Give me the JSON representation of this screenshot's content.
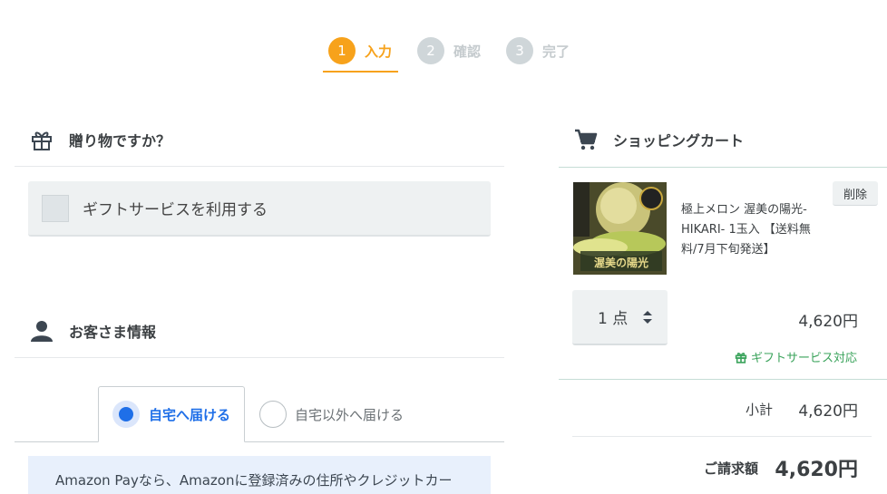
{
  "steps": [
    {
      "num": "1",
      "label": "入力"
    },
    {
      "num": "2",
      "label": "確認"
    },
    {
      "num": "3",
      "label": "完了"
    }
  ],
  "gift": {
    "title": "贈り物ですか？",
    "checkbox_label": "ギフトサービスを利用する",
    "icon": "gift-icon"
  },
  "customer": {
    "title": "お客さま情報",
    "icon": "person-icon",
    "tabs": [
      "自宅へ届ける",
      "自宅以外へ届ける"
    ],
    "note": "Amazon Payなら、Amazonに登録済みの住所やクレジットカー"
  },
  "cart": {
    "title": "ショッピングカート",
    "icon": "cart-icon",
    "item": {
      "name": "極上メロン 渥美の陽光-HIKARI- 1玉入 【送料無料/7月下旬発送】",
      "delete_label": "削除",
      "quantity": "1 点",
      "price": "4,620円",
      "gift_badge": "ギフトサービス対応",
      "image_label": "渥美の陽光"
    },
    "subtotal_label": "小計",
    "subtotal": "4,620円",
    "total_label": "ご請求額",
    "total": "4,620円"
  },
  "colors": {
    "accent": "#f7a21b",
    "primary": "#1f6fe8",
    "success": "#3aa35b"
  }
}
